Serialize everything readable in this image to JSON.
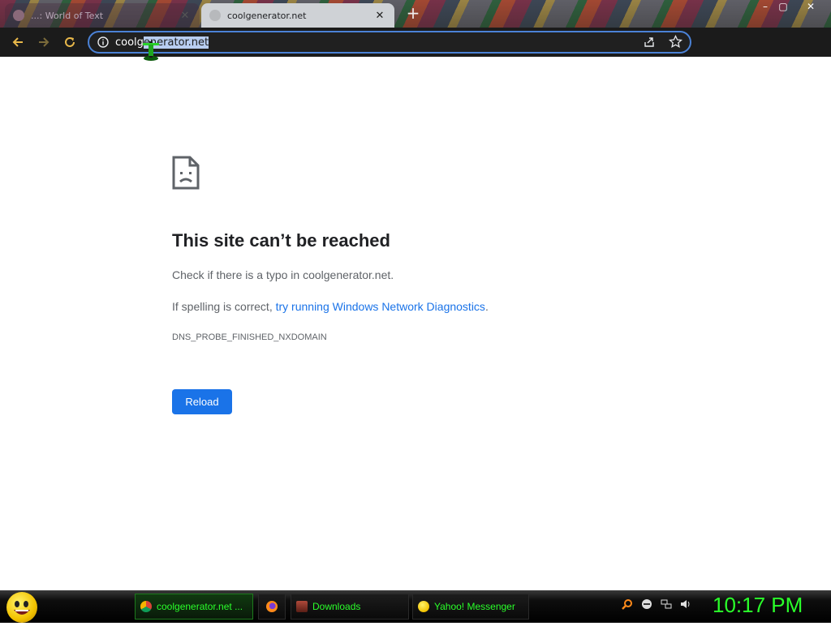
{
  "tabs": [
    {
      "title": "...: World of Text",
      "active": false
    },
    {
      "title": "coolgenerator.net",
      "active": true
    }
  ],
  "window_controls": {
    "minimize": "–",
    "maximize": "▢",
    "close": "✕"
  },
  "omnibox": {
    "url_unselected": "coolg",
    "url_selected": "enerator.net"
  },
  "error_page": {
    "title": "This site can’t be reached",
    "line1": "Check if there is a typo in coolgenerator.net.",
    "line2_prefix": "If spelling is correct, ",
    "line2_link": "try running Windows Network Diagnostics",
    "line2_suffix": ".",
    "error_code": "DNS_PROBE_FINISHED_NXDOMAIN",
    "reload_label": "Reload"
  },
  "taskbar": {
    "items": [
      {
        "label": "coolgenerator.net ...",
        "icon": "chrome-icon"
      },
      {
        "label": "",
        "icon": "firefox-icon"
      },
      {
        "label": "Downloads",
        "icon": "folder-icon"
      },
      {
        "label": "Yahoo! Messenger",
        "icon": "yahoo-icon"
      }
    ],
    "clock": "10:17 PM"
  },
  "colors": {
    "accent_blue": "#1a73e8",
    "taskbar_text": "#2aff2a",
    "omnibox_border": "#4b82d6"
  }
}
